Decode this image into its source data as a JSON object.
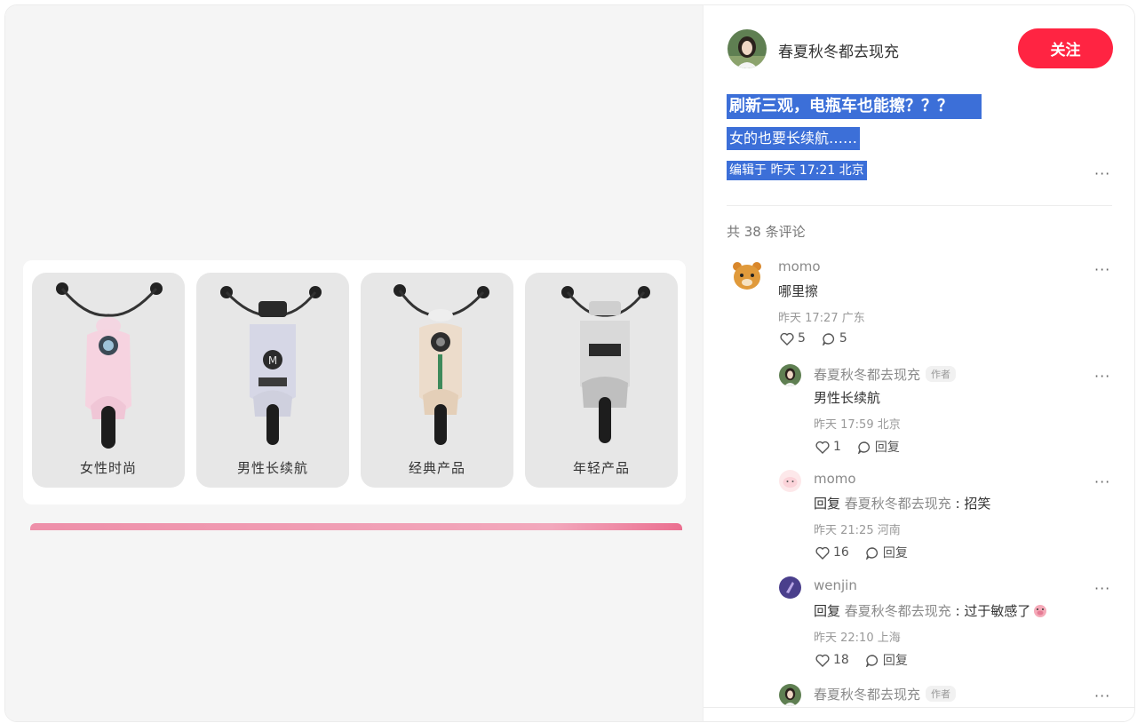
{
  "media": {
    "cards": [
      {
        "label": "女性时尚"
      },
      {
        "label": "男性长续航"
      },
      {
        "label": "经典产品"
      },
      {
        "label": "年轻产品"
      }
    ]
  },
  "author": {
    "name": "春夏秋冬都去现充",
    "follow_label": "关注"
  },
  "post": {
    "title": "刷新三观，电瓶车也能擦？？？",
    "description": "女的也要长续航……",
    "meta": "编辑于 昨天 17:21 北京"
  },
  "comments_count": "共 38 条评论",
  "more_glyph": "···",
  "comments": [
    {
      "name": "momo",
      "text": "哪里擦",
      "time": "昨天 17:27 广东",
      "likes": "5",
      "replies": "5"
    },
    {
      "name": "春夏秋冬都去现充",
      "badge": "作者",
      "text": "男性长续航",
      "time": "昨天 17:59 北京",
      "likes": "1",
      "reply_label": "回复"
    },
    {
      "name": "momo",
      "reply_prefix": "回复",
      "reply_to": "春夏秋冬都去现充",
      "text": " : 招笑",
      "time": "昨天 21:25 河南",
      "likes": "16",
      "reply_label": "回复"
    },
    {
      "name": "wenjin",
      "reply_prefix": "回复",
      "reply_to": "春夏秋冬都去现充",
      "text": " : 过于敏感了",
      "time": "昨天 22:10 上海",
      "likes": "18",
      "reply_label": "回复"
    },
    {
      "name": "春夏秋冬都去现充",
      "badge": "作者"
    }
  ]
}
